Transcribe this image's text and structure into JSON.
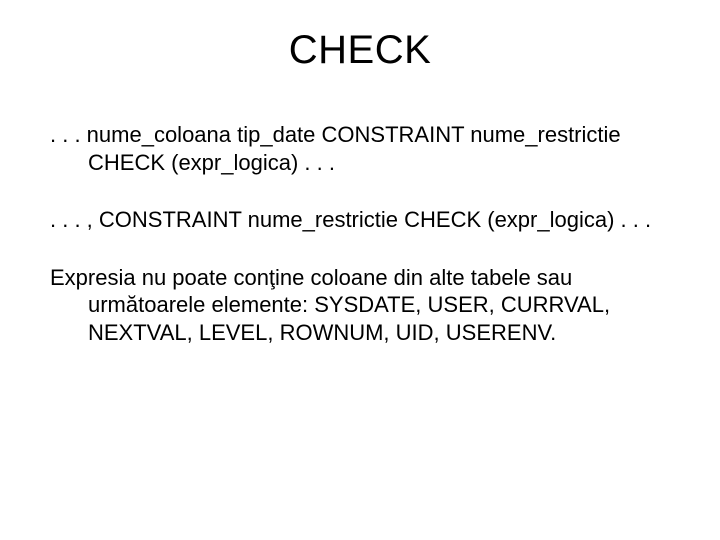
{
  "title": "CHECK",
  "para1_line1": ". . . nume_coloana tip_date CONSTRAINT nume_restrictie",
  "para1_line2": "CHECK (expr_logica) . . .",
  "para2": ". . . , CONSTRAINT nume_restrictie CHECK (expr_logica) . . .",
  "para3_line1": "Expresia nu poate conţine coloane din alte tabele sau",
  "para3_line2": "următoarele elemente: SYSDATE, USER, CURRVAL,",
  "para3_line3": "NEXTVAL, LEVEL, ROWNUM, UID, USERENV."
}
